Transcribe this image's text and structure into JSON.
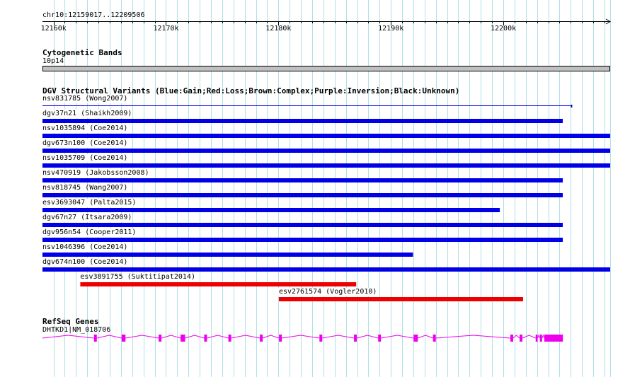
{
  "ruler": {
    "location": "chr10:12159017..12209506",
    "ticks": [
      {
        "label": "12160k",
        "pos": 12160000
      },
      {
        "label": "12170k",
        "pos": 12170000
      },
      {
        "label": "12180k",
        "pos": 12180000
      },
      {
        "label": "12190k",
        "pos": 12190000
      },
      {
        "label": "12200k",
        "pos": 12200000
      }
    ],
    "start": 12159017,
    "end": 12209506
  },
  "cytoband": {
    "title": "Cytogenetic Bands",
    "band_label": "10p14",
    "color": "#c0c0c0"
  },
  "dgv": {
    "title": "DGV Structural Variants (Blue:Gain;Red:Loss;Brown:Complex;Purple:Inversion;Black:Unknown)",
    "colors": {
      "gain": "#0000e6",
      "loss": "#ee0000"
    },
    "features": [
      {
        "label": "nsv831785 (Wong2007)",
        "start": 12159017,
        "end": 12206070,
        "type": "gain",
        "style": "thin"
      },
      {
        "label": "dgv37n21 (Shaikh2009)",
        "start": 12159017,
        "end": 12205290,
        "type": "gain"
      },
      {
        "label": "nsv1035894 (Coe2014)",
        "start": 12159017,
        "end": 12209506,
        "type": "gain"
      },
      {
        "label": "dgv673n100 (Coe2014)",
        "start": 12159017,
        "end": 12209506,
        "type": "gain"
      },
      {
        "label": "nsv1035709 (Coe2014)",
        "start": 12159017,
        "end": 12209506,
        "type": "gain"
      },
      {
        "label": "nsv470919 (Jakobsson2008)",
        "start": 12159017,
        "end": 12205290,
        "type": "gain"
      },
      {
        "label": "nsv818745 (Wang2007)",
        "start": 12159017,
        "end": 12205290,
        "type": "gain"
      },
      {
        "label": "esv3693047 (Palta2015)",
        "start": 12159017,
        "end": 12199690,
        "type": "gain"
      },
      {
        "label": "dgv67n27 (Itsara2009)",
        "start": 12159017,
        "end": 12205290,
        "type": "gain"
      },
      {
        "label": "dgv956n54 (Cooper2011)",
        "start": 12159017,
        "end": 12205290,
        "type": "gain"
      },
      {
        "label": "nsv1046396 (Coe2014)",
        "start": 12159017,
        "end": 12191970,
        "type": "gain"
      },
      {
        "label": "dgv674n100 (Coe2014)",
        "start": 12159017,
        "end": 12209506,
        "type": "gain"
      },
      {
        "label": "esv3891755 (Suktitipat2014)",
        "start": 12162380,
        "end": 12186920,
        "type": "loss"
      },
      {
        "label": "esv2761574 (Vogler2010)",
        "start": 12180040,
        "end": 12201760,
        "type": "loss"
      }
    ]
  },
  "refseq": {
    "title": "RefSeq Genes",
    "gene_label": "DHTKD1|NM_018706",
    "color": "#ee00ee",
    "start": 12159017,
    "end": 12205300,
    "exons": [
      {
        "start": 12163600,
        "end": 12163850
      },
      {
        "start": 12166060,
        "end": 12166400
      },
      {
        "start": 12169350,
        "end": 12169600
      },
      {
        "start": 12171300,
        "end": 12171700
      },
      {
        "start": 12173400,
        "end": 12173650
      },
      {
        "start": 12175550,
        "end": 12175800
      },
      {
        "start": 12178350,
        "end": 12178600
      },
      {
        "start": 12180050,
        "end": 12180300
      },
      {
        "start": 12183650,
        "end": 12183900
      },
      {
        "start": 12186720,
        "end": 12186970
      },
      {
        "start": 12188870,
        "end": 12189120
      },
      {
        "start": 12192020,
        "end": 12192400
      },
      {
        "start": 12193750,
        "end": 12194000
      },
      {
        "start": 12200630,
        "end": 12200880
      },
      {
        "start": 12201450,
        "end": 12201700
      },
      {
        "start": 12202880,
        "end": 12203050
      },
      {
        "start": 12203250,
        "end": 12203450
      },
      {
        "start": 12203650,
        "end": 12205300
      }
    ]
  },
  "grid_color": "#b0dfe8"
}
